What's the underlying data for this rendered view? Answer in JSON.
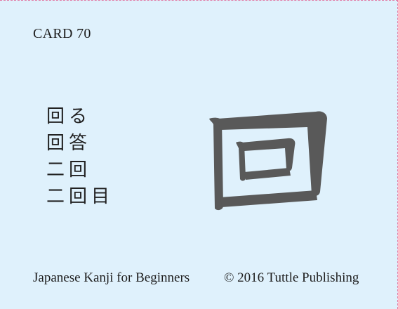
{
  "card": {
    "number_label": "CARD 70",
    "kanji": "回",
    "vocabulary": [
      "回る",
      "回答",
      "二回",
      "二回目"
    ],
    "footer_title": "Japanese Kanji for Beginners",
    "footer_copyright": "© 2016 Tuttle Publishing"
  },
  "colors": {
    "background": "#dff1fc",
    "border": "#e27aa4",
    "glyph": "#595959",
    "text": "#1e1e1e"
  }
}
